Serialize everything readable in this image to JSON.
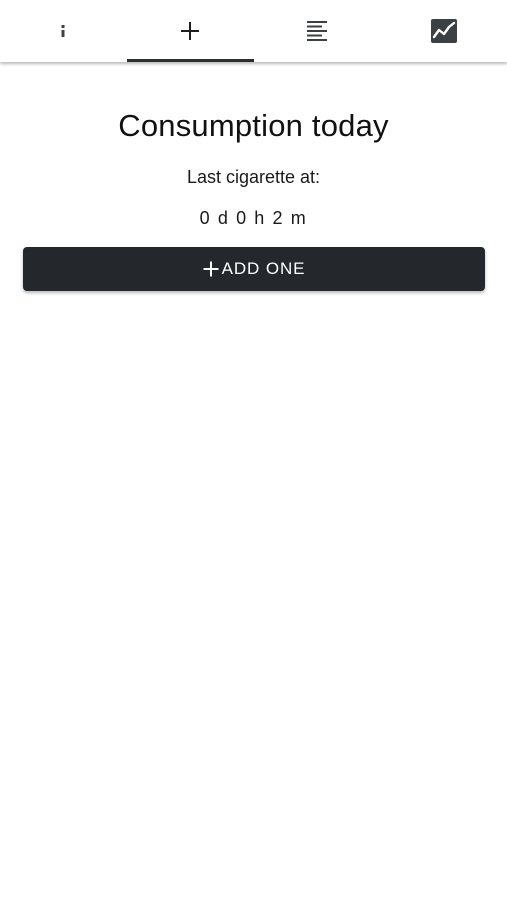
{
  "tabs": [
    {
      "icon": "info-icon",
      "active": false
    },
    {
      "icon": "plus-icon",
      "active": true
    },
    {
      "icon": "list-lines-icon",
      "active": false
    },
    {
      "icon": "chart-icon",
      "active": false
    }
  ],
  "main": {
    "title": "Consumption today",
    "last_label": "Last cigarette at:",
    "elapsed": "0 d 0 h 2 m",
    "add_button_label": "ADD ONE"
  },
  "colors": {
    "button_bg": "#24272b",
    "indicator": "#2b2f33",
    "icon": "#3c4043",
    "text": "#111111"
  }
}
